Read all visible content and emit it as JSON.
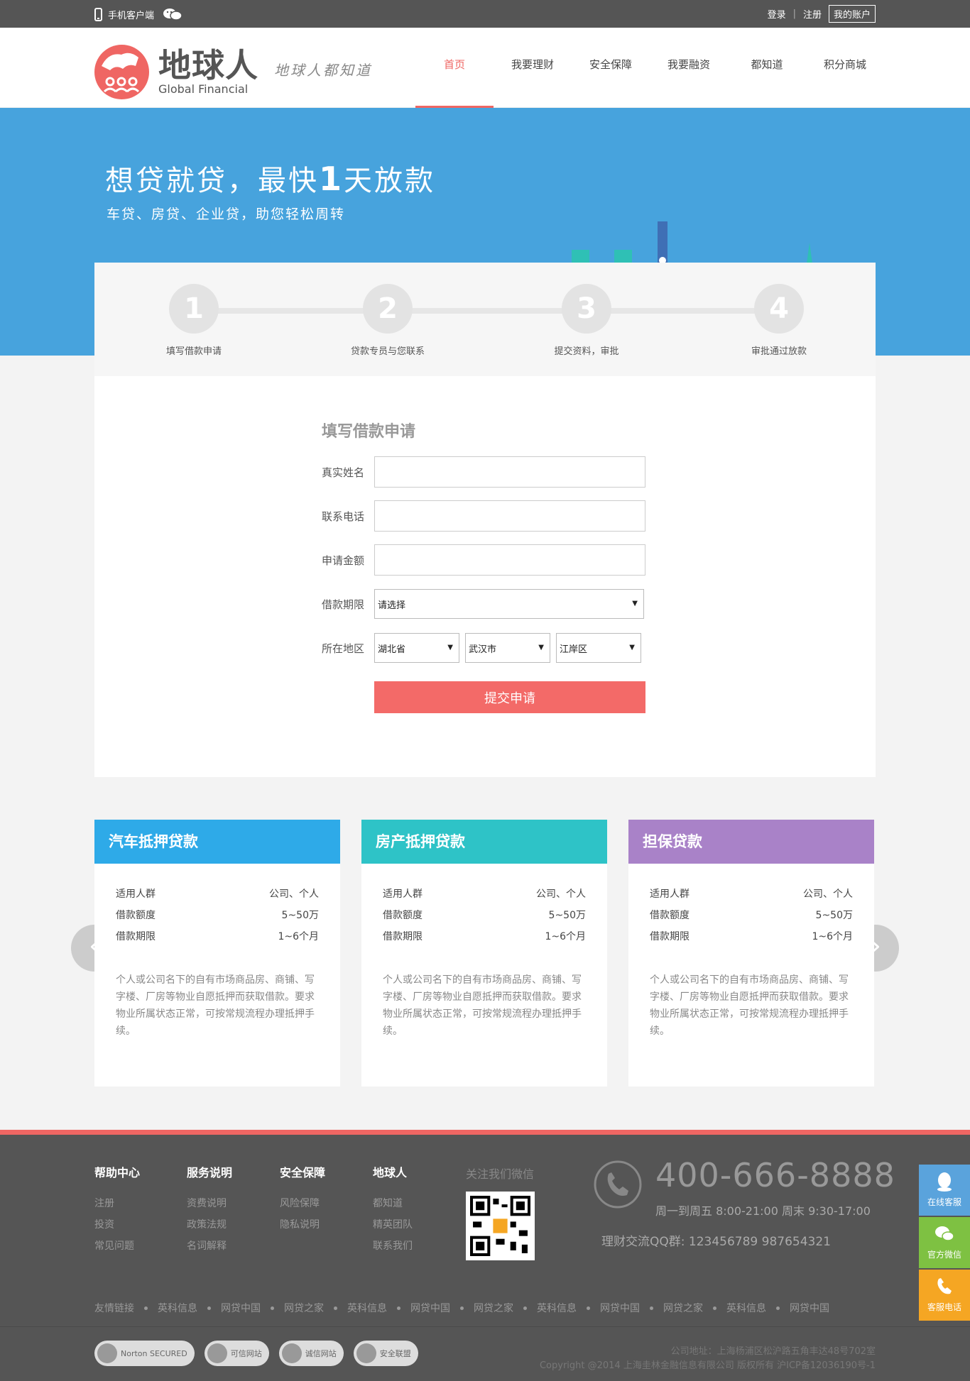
{
  "topbar": {
    "mobile_label": "手机客户端",
    "login": "登录",
    "register": "注册",
    "account": "我的账户"
  },
  "header": {
    "logo_cn": "地球人",
    "logo_en": "Global Financial",
    "slogan": "地球人都知道",
    "nav": [
      "首页",
      "我要理财",
      "安全保障",
      "我要融资",
      "都知道",
      "积分商城"
    ]
  },
  "banner": {
    "headline_pre": "想贷就贷，最快",
    "headline_num": "1",
    "headline_post": "天放款",
    "subline": "车贷、房贷、企业贷，助您轻松周转"
  },
  "steps": [
    {
      "num": "1",
      "label": "填写借款申请"
    },
    {
      "num": "2",
      "label": "贷款专员与您联系"
    },
    {
      "num": "3",
      "label": "提交资料，审批"
    },
    {
      "num": "4",
      "label": "审批通过放款"
    }
  ],
  "form": {
    "title": "填写借款申请",
    "name_label": "真实姓名",
    "phone_label": "联系电话",
    "amount_label": "申请金额",
    "term_label": "借款期限",
    "term_value": "请选择",
    "region_label": "所在地区",
    "province": "湖北省",
    "city": "武汉市",
    "district": "江岸区",
    "submit": "提交申请"
  },
  "cards": [
    {
      "title": "汽车抵押贷款",
      "color": "#2eaae8",
      "rows": [
        [
          "适用人群",
          "公司、个人"
        ],
        [
          "借款额度",
          "5~50万"
        ],
        [
          "借款期限",
          "1~6个月"
        ]
      ],
      "desc": "个人或公司名下的自有市场商品房、商铺、写字楼、厂房等物业自愿抵押而获取借款。要求物业所属状态正常，可按常规流程办理抵押手续。"
    },
    {
      "title": "房产抵押贷款",
      "color": "#2ec3c7",
      "rows": [
        [
          "适用人群",
          "公司、个人"
        ],
        [
          "借款额度",
          "5~50万"
        ],
        [
          "借款期限",
          "1~6个月"
        ]
      ],
      "desc": "个人或公司名下的自有市场商品房、商铺、写字楼、厂房等物业自愿抵押而获取借款。要求物业所属状态正常，可按常规流程办理抵押手续。"
    },
    {
      "title": "担保贷款",
      "color": "#a982c8",
      "rows": [
        [
          "适用人群",
          "公司、个人"
        ],
        [
          "借款额度",
          "5~50万"
        ],
        [
          "借款期限",
          "1~6个月"
        ]
      ],
      "desc": "个人或公司名下的自有市场商品房、商铺、写字楼、厂房等物业自愿抵押而获取借款。要求物业所属状态正常，可按常规流程办理抵押手续。"
    }
  ],
  "footer": {
    "cols": [
      {
        "title": "帮助中心",
        "links": [
          "注册",
          "投资",
          "常见问题"
        ]
      },
      {
        "title": "服务说明",
        "links": [
          "资费说明",
          "政策法规",
          "名词解释"
        ]
      },
      {
        "title": "安全保障",
        "links": [
          "风险保障",
          "隐私说明"
        ]
      },
      {
        "title": "地球人",
        "links": [
          "都知道",
          "精英团队",
          "联系我们"
        ]
      }
    ],
    "qr_title": "关注我们微信",
    "tel": "400-666-8888",
    "hours": "周一到周五  8:00-21:00  周末 9:30-17:00",
    "qq": "理财交流QQ群:  123456789     987654321",
    "links_label": "友情链接",
    "links": [
      "英科信息",
      "网贷中国",
      "网贷之家",
      "英科信息",
      "网贷中国",
      "网贷之家",
      "英科信息",
      "网贷中国",
      "网贷之家",
      "英科信息",
      "网贷中国"
    ],
    "badges": [
      "Norton SECURED",
      "可信网站",
      "诚信网站",
      "安全联盟"
    ],
    "address": "公司地址：上海杨浦区松沪路五角丰达48号702室",
    "copyright": "Copyright @2014 上海圭林金融信息有限公司 版权所有  沪ICP备12036190号-1"
  },
  "side": [
    {
      "label": "在线客服",
      "color": "#5aa3dc",
      "icon": "qq-icon"
    },
    {
      "label": "官方微信",
      "color": "#7ec142",
      "icon": "wechat-icon"
    },
    {
      "label": "客服电话",
      "color": "#f5a623",
      "icon": "phone-icon"
    }
  ]
}
